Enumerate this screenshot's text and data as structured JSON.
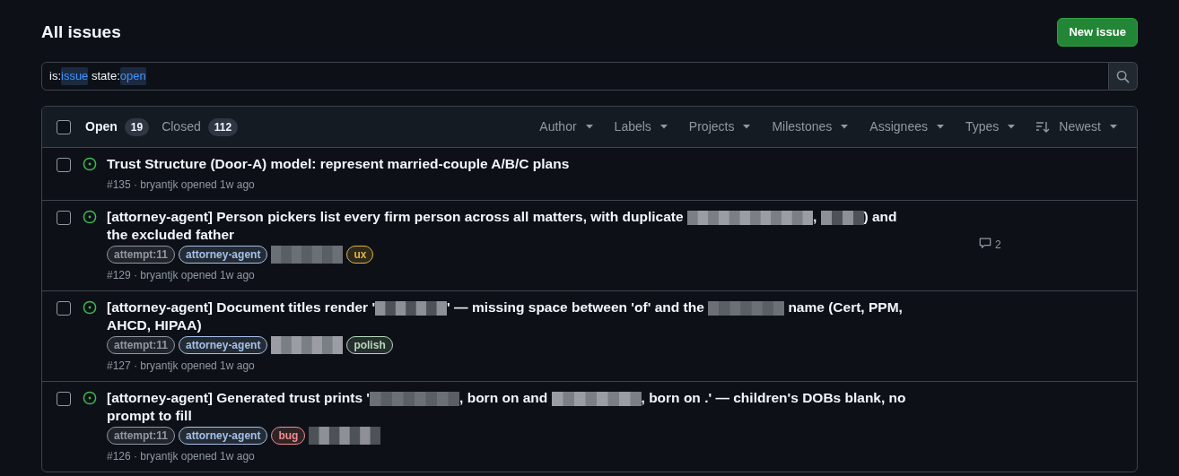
{
  "header": {
    "title": "All issues",
    "new_button": "New issue"
  },
  "search": {
    "query": [
      {
        "text": "is:",
        "kind": "key"
      },
      {
        "text": "issue",
        "kind": "value"
      },
      {
        "text": " state:",
        "kind": "key"
      },
      {
        "text": "open",
        "kind": "value"
      }
    ]
  },
  "select_all": {
    "checked": false
  },
  "state_tabs": [
    {
      "label": "Open",
      "count": "19",
      "selected": true
    },
    {
      "label": "Closed",
      "count": "112",
      "selected": false
    }
  ],
  "filters": [
    {
      "label": "Author",
      "kind": "plain"
    },
    {
      "label": "Labels",
      "kind": "plain"
    },
    {
      "label": "Projects",
      "kind": "plain"
    },
    {
      "label": "Milestones",
      "kind": "plain"
    },
    {
      "label": "Assignees",
      "kind": "plain"
    },
    {
      "label": "Types",
      "kind": "plain"
    },
    {
      "label": "Newest",
      "kind": "sort"
    }
  ],
  "issues": [
    {
      "checked": false,
      "title": [
        {
          "kind": "text",
          "text": "Trust Structure (Door-A) model: represent married-couple A/B/C plans"
        }
      ],
      "meta": "#135 · bryantjk opened 1w ago"
    },
    {
      "checked": false,
      "title": [
        {
          "kind": "text",
          "text": "[attorney-agent] Person pickers list every firm person across all matters, with duplicate "
        },
        {
          "kind": "redacted"
        },
        {
          "kind": "text",
          "text": ", "
        },
        {
          "kind": "redacted"
        },
        {
          "kind": "text",
          "text": ") and the excluded father"
        }
      ],
      "labels": [
        {
          "kind": "label",
          "text": "attempt:11",
          "color": "#9198a1"
        },
        {
          "kind": "label",
          "text": "attorney-agent",
          "color": "#a5c0e6"
        },
        {
          "kind": "redacted"
        },
        {
          "kind": "label",
          "text": "ux",
          "color": "#e3b341"
        }
      ],
      "meta": "#129 · bryantjk opened 1w ago",
      "comments": "2"
    },
    {
      "checked": false,
      "title": [
        {
          "kind": "text",
          "text": "[attorney-agent] Document titles render '"
        },
        {
          "kind": "redacted"
        },
        {
          "kind": "text",
          "text": "' — missing space between 'of' and the "
        },
        {
          "kind": "redacted"
        },
        {
          "kind": "text",
          "text": " name (Cert, PPM, AHCD, HIPAA)"
        }
      ],
      "labels": [
        {
          "kind": "label",
          "text": "attempt:11",
          "color": "#9198a1"
        },
        {
          "kind": "label",
          "text": "attorney-agent",
          "color": "#a5c0e6"
        },
        {
          "kind": "redacted"
        },
        {
          "kind": "label",
          "text": "polish",
          "color": "#b5d8b9"
        }
      ],
      "meta": "#127 · bryantjk opened 1w ago"
    },
    {
      "checked": false,
      "title": [
        {
          "kind": "text",
          "text": "[attorney-agent] Generated trust prints '"
        },
        {
          "kind": "redacted"
        },
        {
          "kind": "text",
          "text": ", born on and "
        },
        {
          "kind": "redacted"
        },
        {
          "kind": "text",
          "text": ", born on .' — children's DOBs blank, no prompt to fill"
        }
      ],
      "labels": [
        {
          "kind": "label",
          "text": "attempt:11",
          "color": "#9198a1"
        },
        {
          "kind": "label",
          "text": "attorney-agent",
          "color": "#a5c0e6"
        },
        {
          "kind": "label",
          "text": "bug",
          "color": "#f08c8c"
        },
        {
          "kind": "redacted"
        }
      ],
      "meta": "#126 · bryantjk opened 1w ago"
    }
  ]
}
